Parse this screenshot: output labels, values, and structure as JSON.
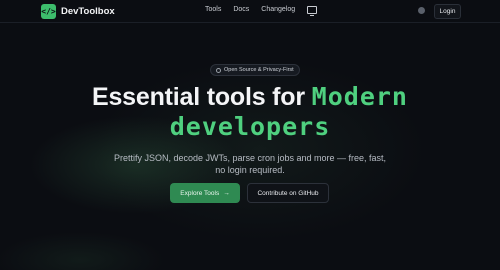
{
  "nav": {
    "brand": "DevToolbox",
    "brand_icon": "</>",
    "links": [
      "Tools",
      "Docs",
      "Changelog"
    ],
    "login_label": "Login"
  },
  "hero": {
    "badge": "Open Source & Privacy-First",
    "title_plain": "Essential tools for",
    "title_accent_1": "Modern",
    "title_accent_2": "developers",
    "subtitle_line1": "Prettify JSON, decode JWTs, parse cron jobs and more — free, fast,",
    "subtitle_line2": "no login required.",
    "primary_button": "Explore Tools",
    "primary_arrow": "→",
    "secondary_button": "Contribute on GitHub"
  },
  "colors": {
    "background": "#0b0d12",
    "accent": "#4fd07f",
    "primary_button": "#2f8a52"
  },
  "icons": {
    "brand": "code-icon",
    "monitor": "monitor-icon",
    "theme": "theme-toggle-icon",
    "badge": "shield-icon"
  }
}
